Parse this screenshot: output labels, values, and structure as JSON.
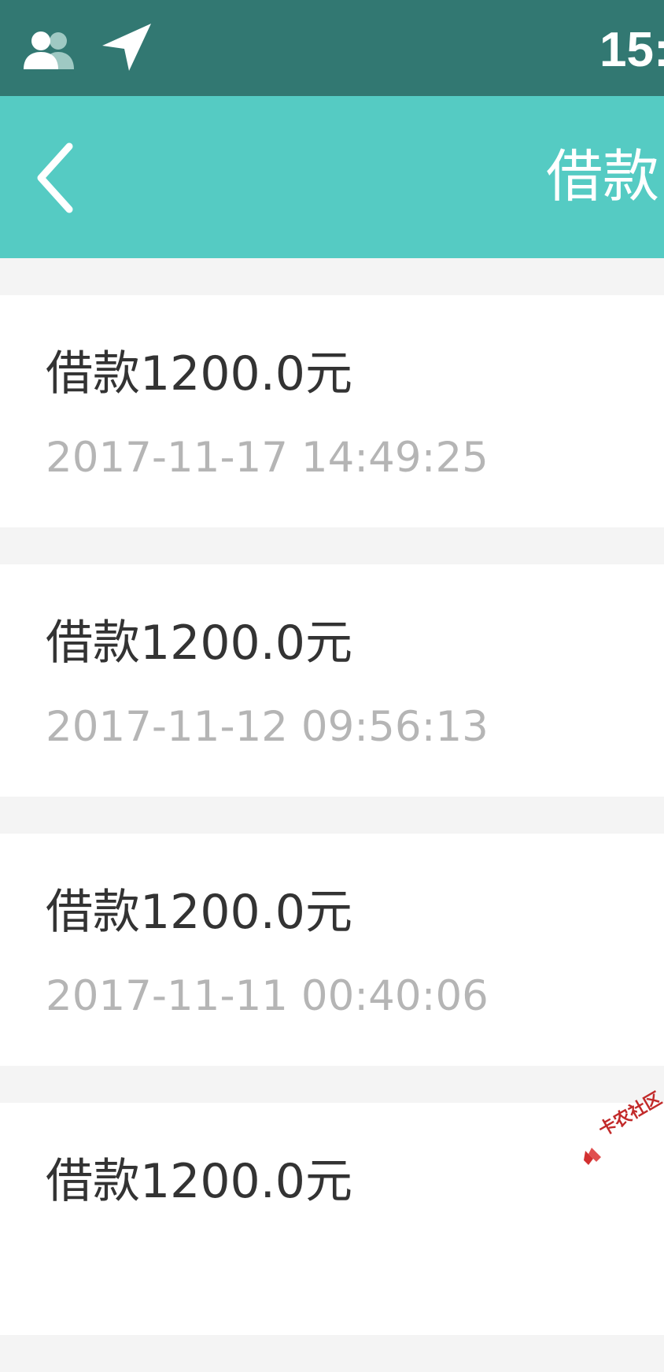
{
  "status_bar": {
    "time": "15:",
    "icons": [
      "people-icon",
      "location-arrow-icon"
    ]
  },
  "nav": {
    "title": "借款",
    "back_icon": "chevron-left-icon"
  },
  "items": [
    {
      "title": "借款1200.0元",
      "time": "2017-11-17 14:49:25"
    },
    {
      "title": "借款1200.0元",
      "time": "2017-11-12 09:56:13"
    },
    {
      "title": "借款1200.0元",
      "time": "2017-11-11 00:40:06"
    },
    {
      "title": "借款1200.0元",
      "time": ""
    }
  ],
  "watermark": {
    "text": "卡农社区"
  },
  "colors": {
    "status_bar": "#327872",
    "nav_bar": "#55cbc3",
    "background": "#f4f4f4",
    "card": "#ffffff",
    "title_text": "#333333",
    "time_text": "#b5b5b5"
  }
}
